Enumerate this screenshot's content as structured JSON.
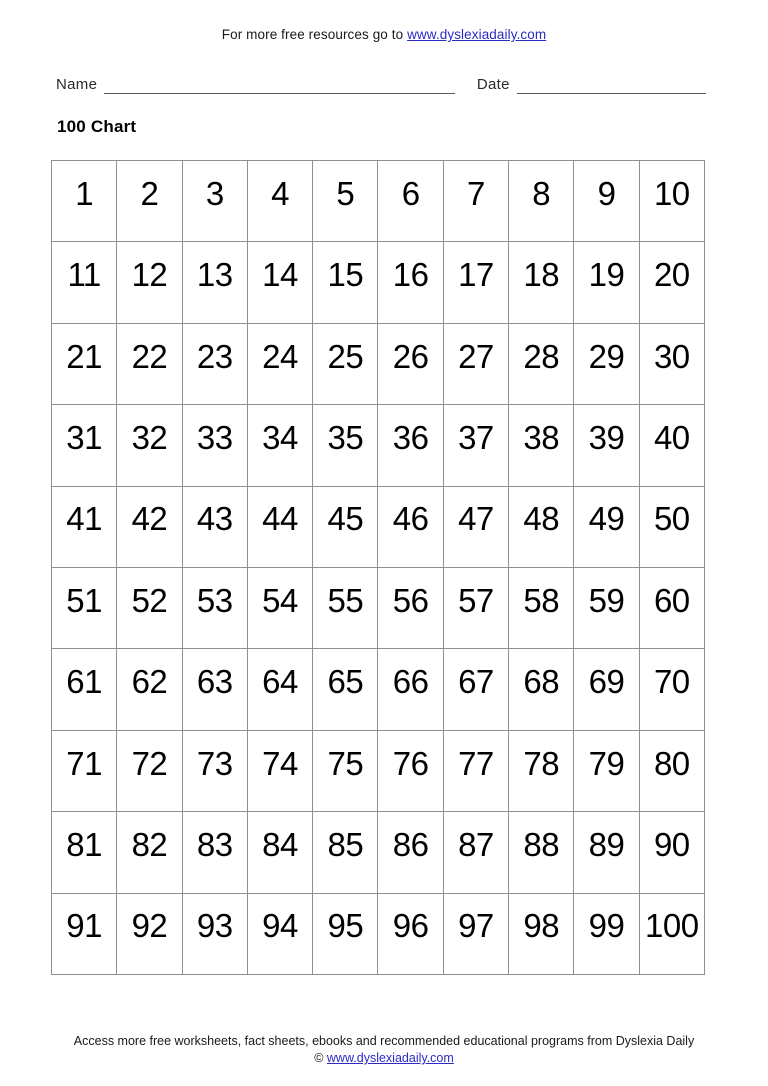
{
  "header": {
    "resource_text_before": "For more free resources go to ",
    "resource_link": "www.dyslexiadaily.com"
  },
  "form": {
    "name_label": "Name",
    "date_label": "Date"
  },
  "worksheet": {
    "title": "100 Chart"
  },
  "chart_data": {
    "type": "table",
    "title": "100 Chart",
    "rows": 10,
    "columns": 10,
    "grid": [
      [
        1,
        2,
        3,
        4,
        5,
        6,
        7,
        8,
        9,
        10
      ],
      [
        11,
        12,
        13,
        14,
        15,
        16,
        17,
        18,
        19,
        20
      ],
      [
        21,
        22,
        23,
        24,
        25,
        26,
        27,
        28,
        29,
        30
      ],
      [
        31,
        32,
        33,
        34,
        35,
        36,
        37,
        38,
        39,
        40
      ],
      [
        41,
        42,
        43,
        44,
        45,
        46,
        47,
        48,
        49,
        50
      ],
      [
        51,
        52,
        53,
        54,
        55,
        56,
        57,
        58,
        59,
        60
      ],
      [
        61,
        62,
        63,
        64,
        65,
        66,
        67,
        68,
        69,
        70
      ],
      [
        71,
        72,
        73,
        74,
        75,
        76,
        77,
        78,
        79,
        80
      ],
      [
        81,
        82,
        83,
        84,
        85,
        86,
        87,
        88,
        89,
        90
      ],
      [
        91,
        92,
        93,
        94,
        95,
        96,
        97,
        98,
        99,
        100
      ]
    ],
    "border_color": "#8f8f8f"
  },
  "footer": {
    "line1": "Access more free worksheets, fact sheets, ebooks and recommended educational programs from Dyslexia Daily",
    "copyright_symbol": "© ",
    "link": "www.dyslexiadaily.com"
  },
  "colors": {
    "link": "#2b2bc4",
    "text": "#000000",
    "rule": "#5a5a5a",
    "grid_border": "#8f8f8f",
    "page_background": "#ffffff"
  }
}
